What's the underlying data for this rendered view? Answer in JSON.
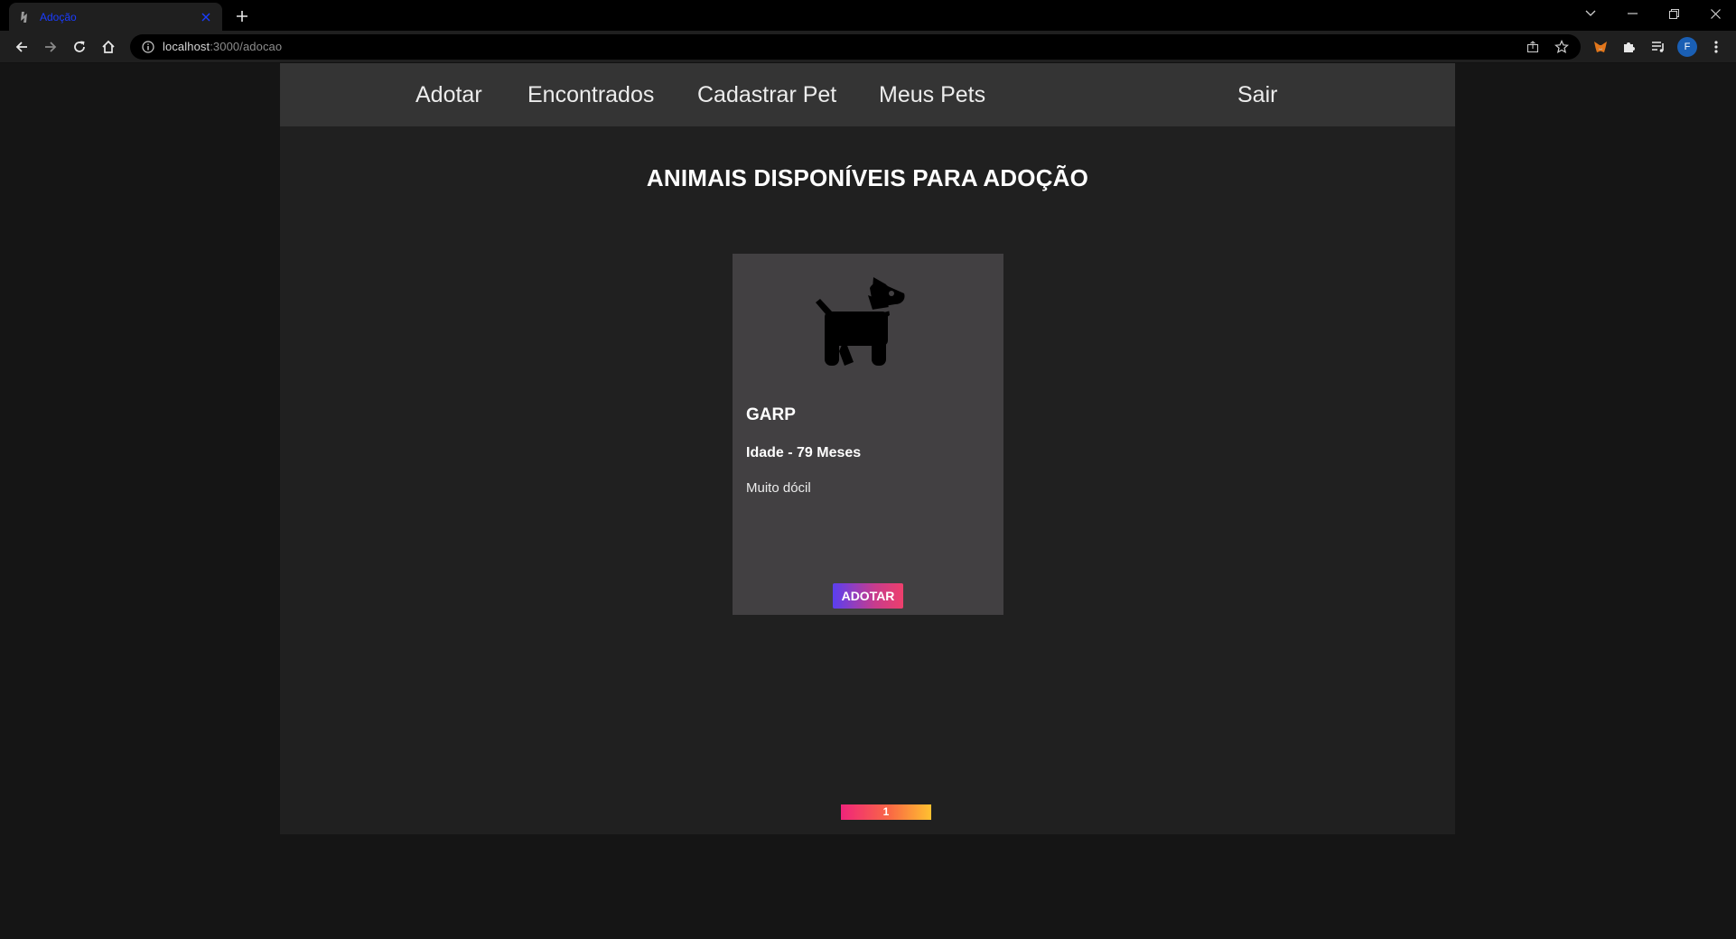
{
  "browser": {
    "tab": {
      "title": "Adoção",
      "favicon": "site-favicon"
    },
    "address": {
      "host": "localhost",
      "path": ":3000/adocao"
    },
    "profile_initial": "F"
  },
  "navbar": {
    "adotar": "Adotar",
    "encontrados": "Encontrados",
    "cadastrar": "Cadastrar Pet",
    "meus_pets": "Meus Pets",
    "sair": "Sair"
  },
  "page": {
    "title": "ANIMAIS DISPONÍVEIS PARA ADOÇÃO"
  },
  "pets": [
    {
      "icon": "dog-icon",
      "name": "GARP",
      "age": "Idade - 79 Meses",
      "description": "Muito dócil",
      "button": "ADOTAR"
    }
  ],
  "pagination": {
    "current": "1"
  },
  "colors": {
    "page_bg": "#151515",
    "app_bg": "#202020",
    "navbar_bg": "#343434",
    "card_bg": "#424042",
    "adopt_gradient": [
      "#5a3ff0",
      "#ee3f6c"
    ],
    "pagination_gradient": [
      "#f0247a",
      "#ffc130"
    ]
  }
}
